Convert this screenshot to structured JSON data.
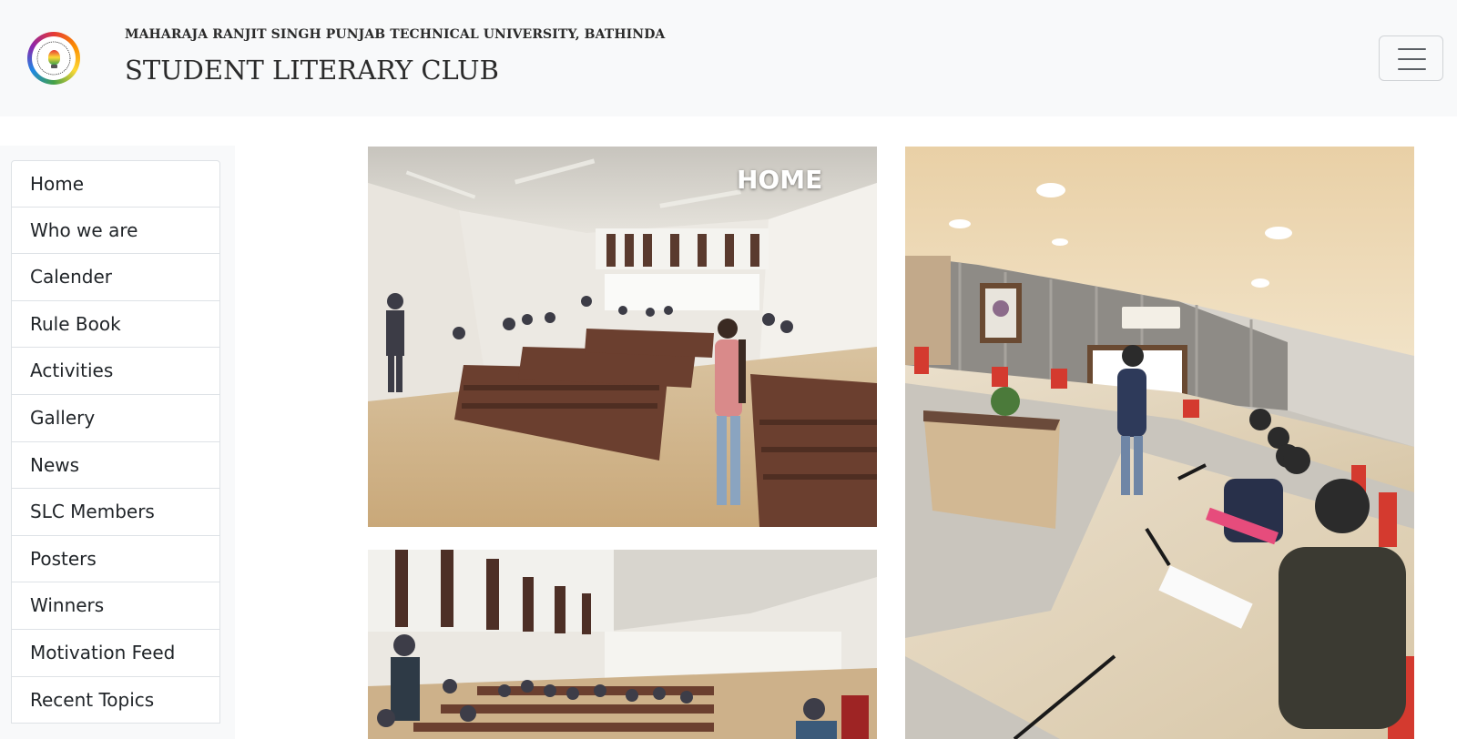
{
  "header": {
    "university": "MAHARAJA RANJIT SINGH PUNJAB TECHNICAL UNIVERSITY, BATHINDA",
    "club": "STUDENT LITERARY CLUB",
    "logo_icon": "student-literary-club-logo",
    "menu_icon": "hamburger-menu-icon"
  },
  "sidebar": {
    "items": [
      {
        "label": "Home"
      },
      {
        "label": "Who we are"
      },
      {
        "label": "Calender"
      },
      {
        "label": "Rule Book"
      },
      {
        "label": "Activities"
      },
      {
        "label": "Gallery"
      },
      {
        "label": "News"
      },
      {
        "label": "SLC Members"
      },
      {
        "label": "Posters"
      },
      {
        "label": "Winners"
      },
      {
        "label": "Motivation Feed"
      },
      {
        "label": "Recent Topics"
      }
    ]
  },
  "gallery": {
    "photos": [
      {
        "overlay": "HOME"
      },
      {
        "overlay": ""
      },
      {
        "overlay": ""
      }
    ]
  },
  "colors": {
    "header_bg": "#f8f9fa",
    "text": "#212529",
    "border": "#dee2e6"
  }
}
